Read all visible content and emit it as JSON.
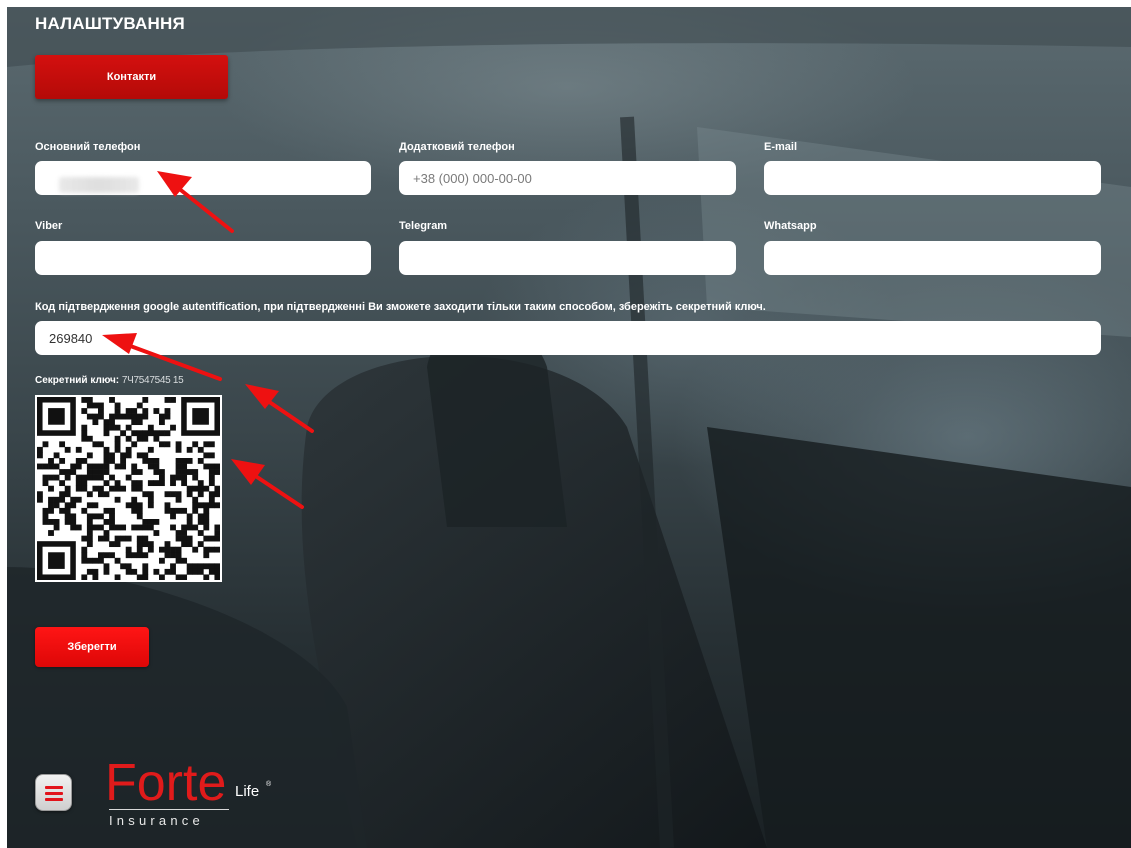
{
  "page": {
    "title": "НАЛАШТУВАННЯ"
  },
  "tabs": {
    "contacts_label": "Контакти"
  },
  "fields": {
    "main_phone": {
      "label": "Основний телефон",
      "value": "",
      "placeholder": ""
    },
    "extra_phone": {
      "label": "Додатковий телефон",
      "value": "",
      "placeholder": "+38 (000) 000-00-00"
    },
    "email": {
      "label": "E-mail",
      "value": ""
    },
    "viber": {
      "label": "Viber",
      "value": ""
    },
    "telegram": {
      "label": "Telegram",
      "value": ""
    },
    "whatsapp": {
      "label": "Whatsapp",
      "value": ""
    },
    "auth_code": {
      "label": "Код підтвердження google autentification, при підтвердженні Ви зможете заходити тільки таким способом, збережіть секретний ключ.",
      "value": "269840"
    }
  },
  "secret": {
    "label": "Секретний ключ:",
    "value": "7Ч7547545 15"
  },
  "actions": {
    "save_label": "Зберегти"
  },
  "footer": {
    "menu_icon": "hamburger-menu-icon",
    "logo": {
      "brand": "Forte",
      "sub": "Life",
      "reg": "®",
      "tagline": "Insurance"
    }
  },
  "colors": {
    "accent_red": "#e2131b",
    "input_bg": "#ffffff",
    "label_text": "#ffffff"
  }
}
